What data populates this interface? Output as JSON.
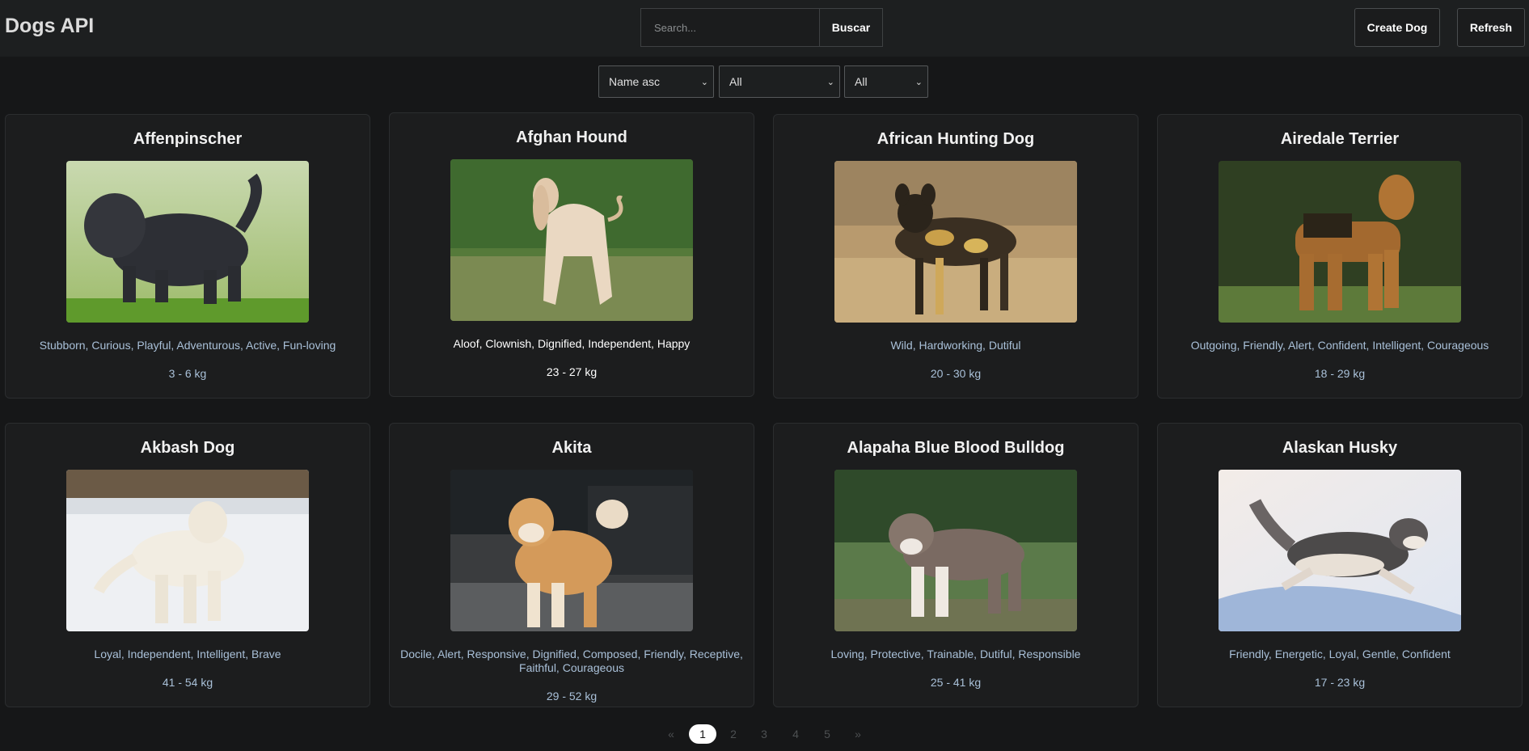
{
  "header": {
    "title": "Dogs API",
    "search_placeholder": "Search...",
    "search_button": "Buscar",
    "create_button": "Create Dog",
    "refresh_button": "Refresh"
  },
  "filters": {
    "sort": "Name asc",
    "temperament": "All",
    "origin": "All"
  },
  "cards": [
    {
      "name": "Affenpinscher",
      "temperament": "Stubborn, Curious, Playful, Adventurous, Active, Fun-loving",
      "weight": "3 - 6 kg"
    },
    {
      "name": "Afghan Hound",
      "temperament": "Aloof, Clownish, Dignified, Independent, Happy",
      "weight": "23 - 27 kg"
    },
    {
      "name": "African Hunting Dog",
      "temperament": "Wild, Hardworking, Dutiful",
      "weight": "20 - 30 kg"
    },
    {
      "name": "Airedale Terrier",
      "temperament": "Outgoing, Friendly, Alert, Confident, Intelligent, Courageous",
      "weight": "18 - 29 kg"
    },
    {
      "name": "Akbash Dog",
      "temperament": "Loyal, Independent, Intelligent, Brave",
      "weight": "41 - 54 kg"
    },
    {
      "name": "Akita",
      "temperament": "Docile, Alert, Responsive, Dignified, Composed, Friendly, Receptive, Faithful, Courageous",
      "weight": "29 - 52 kg"
    },
    {
      "name": "Alapaha Blue Blood Bulldog",
      "temperament": "Loving, Protective, Trainable, Dutiful, Responsible",
      "weight": "25 - 41 kg"
    },
    {
      "name": "Alaskan Husky",
      "temperament": "Friendly, Energetic, Loyal, Gentle, Confident",
      "weight": "17 - 23 kg"
    }
  ],
  "pagination": {
    "prev": "«",
    "pages": [
      "1",
      "2",
      "3",
      "4",
      "5"
    ],
    "current": "1",
    "next": "»"
  }
}
